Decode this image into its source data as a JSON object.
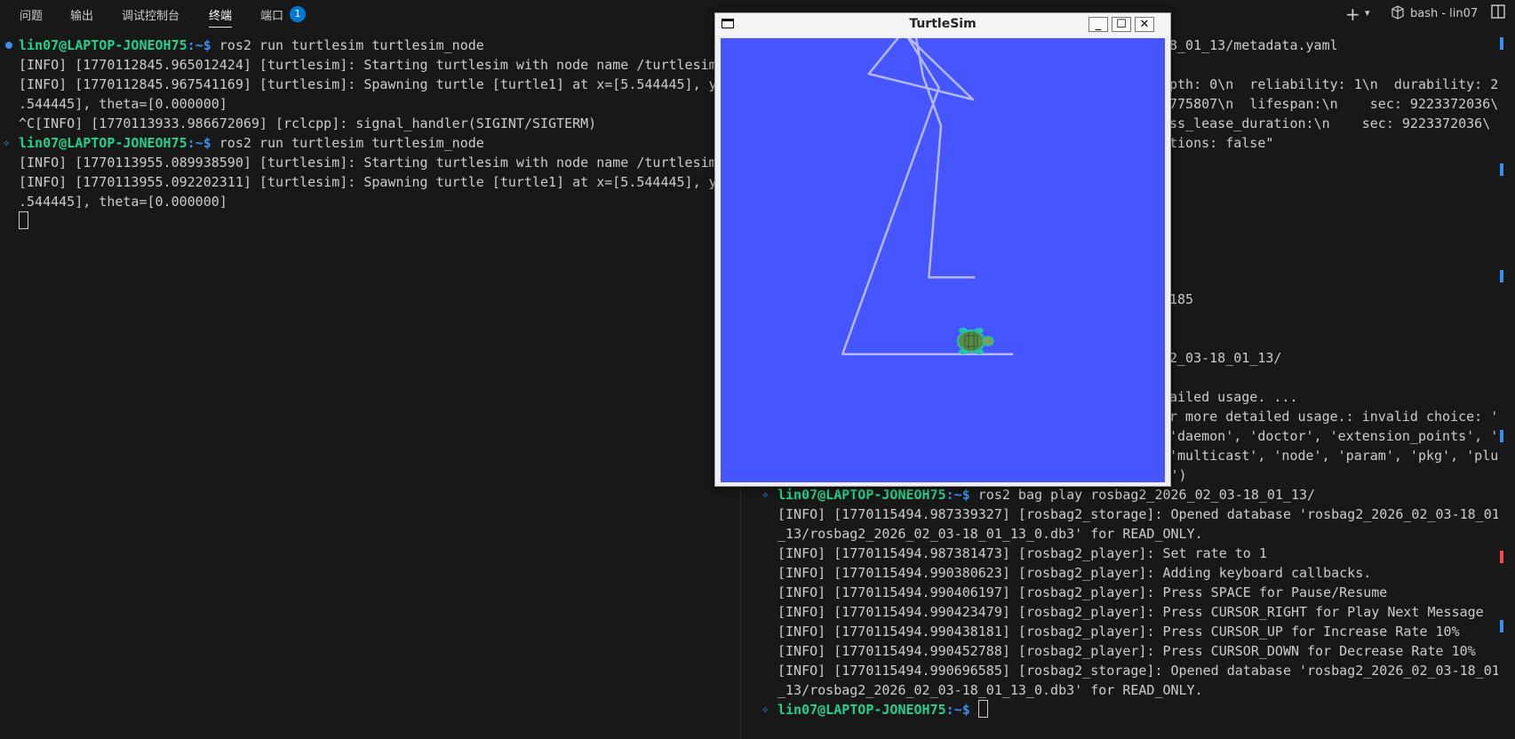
{
  "panel": {
    "tabs": [
      {
        "label": "问题"
      },
      {
        "label": "输出"
      },
      {
        "label": "调试控制台"
      },
      {
        "label": "终端"
      },
      {
        "label": "端口"
      }
    ],
    "ports_badge": "1",
    "active_tab": "终端",
    "terminal_name": "bash - lin07"
  },
  "prompt": {
    "user": "lin07@LAPTOP-JONEOH75",
    "sep": ":~$"
  },
  "left_terminal": {
    "lines": [
      {
        "type": "prompt",
        "cmd": " ros2 run turtlesim turtlesim_node"
      },
      {
        "type": "text",
        "text": "[INFO] [1770112845.965012424] [turtlesim]: Starting turtlesim with node name /turtlesim"
      },
      {
        "type": "text",
        "text": "[INFO] [1770112845.967541169] [turtlesim]: Spawning turtle [turtle1] at x=[5.544445], y"
      },
      {
        "type": "text",
        "text": ".544445], theta=[0.000000]"
      },
      {
        "type": "text",
        "text": "^C[INFO] [1770113933.986672069] [rclcpp]: signal_handler(SIGINT/SIGTERM)"
      },
      {
        "type": "prompt",
        "cmd": " ros2 run turtlesim turtlesim_node"
      },
      {
        "type": "text",
        "text": "[INFO] [1770113955.089938590] [turtlesim]: Starting turtlesim with node name /turtlesim"
      },
      {
        "type": "text",
        "text": "[INFO] [1770113955.092202311] [turtlesim]: Spawning turtle [turtle1] at x=[5.544445], y"
      },
      {
        "type": "text",
        "text": ".544445], theta=[0.000000]"
      }
    ]
  },
  "right_terminal": {
    "top_fragments": [
      "8_01_13/metadata.yaml",
      "",
      "pth: 0\\n  reliability: 1\\n  durability: 2",
      "775807\\n  lifespan:\\n    sec: 9223372036\\",
      "ss_lease_duration:\\n    sec: 9223372036\\",
      "tions: false\"",
      "185",
      "2_03-18_01_13/",
      "ailed usage. ...",
      "r more detailed usage.: invalid choice: '",
      "'daemon', 'doctor', 'extension_points', '",
      "'multicast', 'node', 'param', 'pkg', 'plu"
    ],
    "lines": [
      "gin', 'run', 'security', 'service', 'topic', 'wtf')",
      "__PROMPT__ ros2 bag play rosbag2_2026_02_03-18_01_13/",
      "[INFO] [1770115494.987339327] [rosbag2_storage]: Opened database 'rosbag2_2026_02_03-18_01",
      "_13/rosbag2_2026_02_03-18_01_13_0.db3' for READ_ONLY.",
      "[INFO] [1770115494.987381473] [rosbag2_player]: Set rate to 1",
      "[INFO] [1770115494.990380623] [rosbag2_player]: Adding keyboard callbacks.",
      "[INFO] [1770115494.990406197] [rosbag2_player]: Press SPACE for Pause/Resume",
      "[INFO] [1770115494.990423479] [rosbag2_player]: Press CURSOR_RIGHT for Play Next Message",
      "[INFO] [1770115494.990438181] [rosbag2_player]: Press CURSOR_UP for Increase Rate 10%",
      "[INFO] [1770115494.990452788] [rosbag2_player]: Press CURSOR_DOWN for Decrease Rate 10%",
      "[INFO] [1770115494.990696585] [rosbag2_storage]: Opened database 'rosbag2_2026_02_03-18_01",
      "_13/rosbag2_2026_02_03-18_01_13_0.db3' for READ_ONLY."
    ]
  },
  "turtlesim": {
    "title": "TurtleSim",
    "background": "#4556ff",
    "pen_color": "#b3b8ff",
    "turtle_color": "#3aa05a",
    "path_units": [
      [
        7.3,
        3.2
      ],
      [
        3.05,
        3.2
      ],
      [
        3.05,
        3.22
      ],
      [
        5.45,
        9.85
      ],
      [
        4.65,
        11.15
      ],
      [
        6.3,
        9.56
      ],
      [
        3.7,
        10.2
      ],
      [
        4.8,
        11.55
      ],
      [
        5.05,
        10.15
      ],
      [
        5.5,
        8.9
      ],
      [
        5.2,
        5.12
      ],
      [
        6.35,
        5.12
      ]
    ]
  },
  "colors": {
    "background": "#181818",
    "text": "#cccccc",
    "prompt_user": "#23d18b",
    "prompt_path": "#3b8eea",
    "accent": "#0078d4"
  }
}
